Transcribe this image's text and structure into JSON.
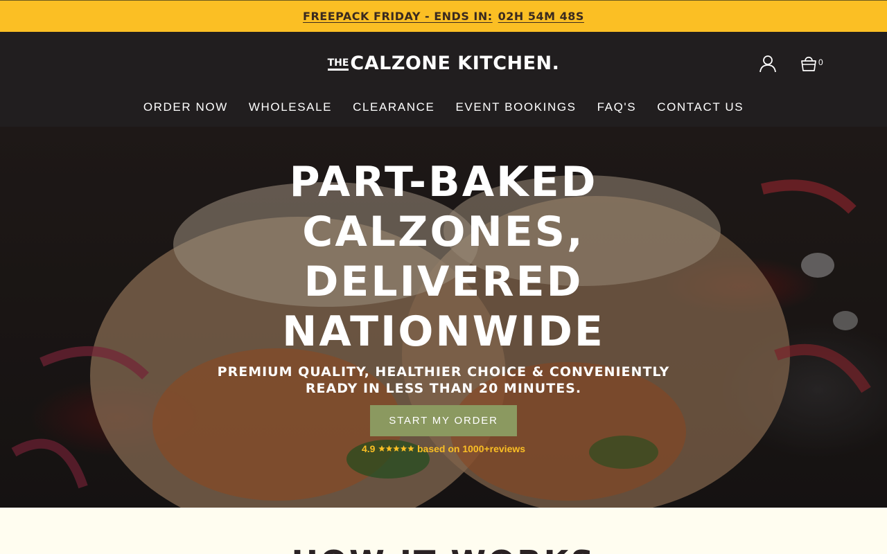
{
  "announcement": {
    "label": "FREEPACK FRIDAY - ENDS IN:",
    "countdown": "02H 54M 48S"
  },
  "header": {
    "logo_prefix": "THE",
    "logo_text": "CALZONE KITCHEN.",
    "cart_count": "0",
    "icons": [
      "account-icon",
      "cart-basket-icon"
    ]
  },
  "nav": {
    "items": [
      {
        "label": "ORDER NOW"
      },
      {
        "label": "WHOLESALE"
      },
      {
        "label": "CLEARANCE"
      },
      {
        "label": "EVENT BOOKINGS"
      },
      {
        "label": "FAQ'S"
      },
      {
        "label": "CONTACT US"
      }
    ]
  },
  "hero": {
    "title": "PART-BAKED CALZONES, DELIVERED NATIONWIDE",
    "subtitle": "PREMIUM QUALITY, HEALTHIER CHOICE & CONVENIENTLY READY IN LESS THAN 20 MINUTES.",
    "cta_label": "START MY ORDER",
    "rating_value": "4.9",
    "rating_stars": 5,
    "reviews_text": "based on 1000+reviews"
  },
  "how_it_works": {
    "title": "HOW IT WORKS"
  },
  "colors": {
    "announcement_bg": "#fbbf24",
    "header_bg": "#211e1f",
    "cta_bg": "#8b9960",
    "rating_accent": "#fbbf24",
    "section_bg": "#fffdf0"
  }
}
